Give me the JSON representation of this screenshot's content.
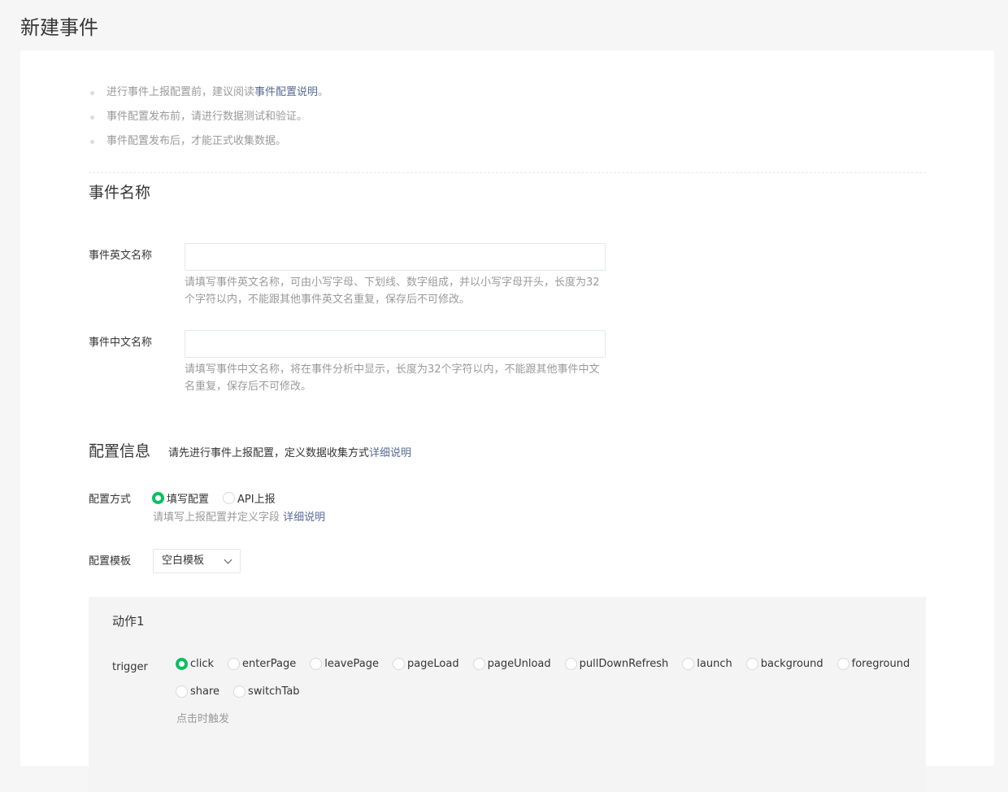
{
  "page": {
    "title": "新建事件"
  },
  "tips": {
    "tip1_prefix": "进行事件上报配置前，建议阅读",
    "tip1_link": "事件配置说明",
    "tip1_suffix": "。",
    "tip2": "事件配置发布前，请进行数据测试和验证。",
    "tip3": "事件配置发布后，才能正式收集数据。"
  },
  "event_name": {
    "section_title": "事件名称",
    "english": {
      "label": "事件英文名称",
      "value": "",
      "hint": "请填写事件英文名称，可由小写字母、下划线、数字组成，并以小写字母开头，长度为32个字符以内，不能跟其他事件英文名重复，保存后不可修改。"
    },
    "chinese": {
      "label": "事件中文名称",
      "value": "",
      "hint": "请填写事件中文名称，将在事件分析中显示，长度为32个字符以内，不能跟其他事件中文名重复，保存后不可修改。"
    }
  },
  "config": {
    "section_title": "配置信息",
    "desc_prefix": "请先进行事件上报配置，定义数据收集方式",
    "desc_link": "详细说明",
    "method": {
      "label": "配置方式",
      "options": [
        "填写配置",
        "API上报"
      ],
      "selected": "填写配置",
      "hint_prefix": "请填写上报配置并定义字段",
      "hint_link": "详细说明"
    },
    "template": {
      "label": "配置模板",
      "selected": "空白模板",
      "icon": "chevron-down-icon"
    }
  },
  "action": {
    "title": "动作1",
    "trigger_label": "trigger",
    "options": [
      "click",
      "enterPage",
      "leavePage",
      "pageLoad",
      "pageUnload",
      "pullDownRefresh",
      "launch",
      "background",
      "foreground",
      "share",
      "switchTab"
    ],
    "selected": "click",
    "hint": "点击时触发"
  },
  "colors": {
    "accent_green": "#07c160",
    "link_blue": "#576b95",
    "hint_gray": "#9a9a9a",
    "background": "#f6f6f6",
    "action_panel": "#f4f4f4"
  }
}
